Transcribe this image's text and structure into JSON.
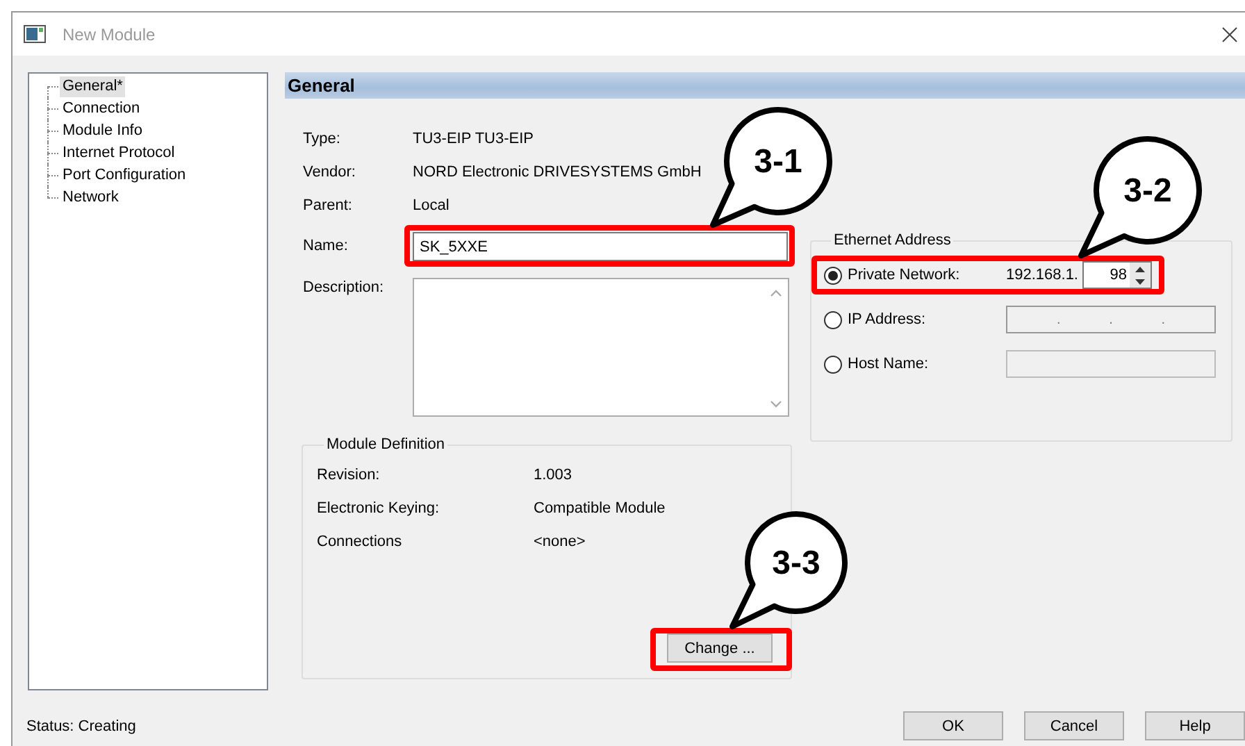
{
  "window": {
    "title": "New Module"
  },
  "tree": [
    {
      "label": "General*",
      "selected": true
    },
    {
      "label": "Connection",
      "selected": false
    },
    {
      "label": "Module Info",
      "selected": false
    },
    {
      "label": "Internet Protocol",
      "selected": false
    },
    {
      "label": "Port Configuration",
      "selected": false
    },
    {
      "label": "Network",
      "selected": false
    }
  ],
  "section_title": "General",
  "info": [
    {
      "label": "Type:",
      "value": "TU3-EIP TU3-EIP"
    },
    {
      "label": "Vendor:",
      "value": "NORD Electronic DRIVESYSTEMS GmbH"
    },
    {
      "label": "Parent:",
      "value": "Local"
    }
  ],
  "name": {
    "label": "Name:",
    "value": "SK_5XXE"
  },
  "description": {
    "label": "Description:"
  },
  "module_definition": {
    "title": "Module Definition",
    "rows": [
      {
        "label": "Revision:",
        "value": "1.003"
      },
      {
        "label": "Electronic Keying:",
        "value": "Compatible Module"
      },
      {
        "label": "Connections",
        "value": "<none>"
      }
    ],
    "button": "Change ..."
  },
  "ethernet": {
    "title": "Ethernet Address",
    "options": [
      {
        "kind": "private",
        "label": "Private Network:",
        "selected": true,
        "prefix": "192.168.1.",
        "value": "98"
      },
      {
        "kind": "ip",
        "label": "IP Address:",
        "selected": false,
        "separators": [
          ".",
          ".",
          "."
        ]
      },
      {
        "kind": "host",
        "label": "Host Name:",
        "selected": false
      }
    ]
  },
  "status": "Status: Creating",
  "buttons": [
    "OK",
    "Cancel",
    "Help"
  ],
  "callouts": [
    "3-1",
    "3-2",
    "3-3"
  ]
}
